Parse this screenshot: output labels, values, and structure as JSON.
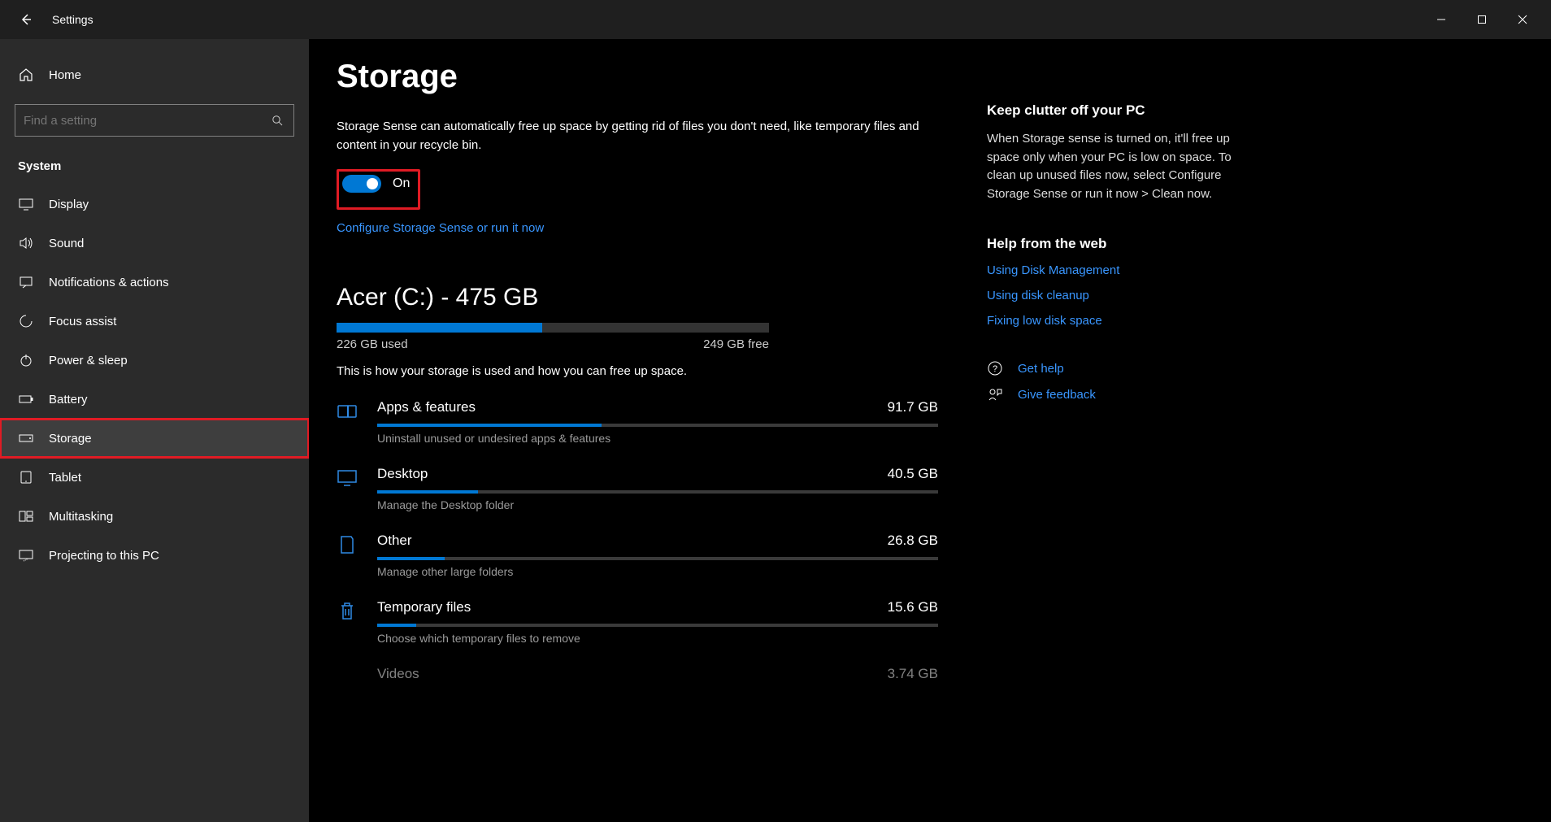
{
  "app": {
    "title": "Settings"
  },
  "sidebar": {
    "home_label": "Home",
    "search_placeholder": "Find a setting",
    "section": "System",
    "items": [
      {
        "label": "Display"
      },
      {
        "label": "Sound"
      },
      {
        "label": "Notifications & actions"
      },
      {
        "label": "Focus assist"
      },
      {
        "label": "Power & sleep"
      },
      {
        "label": "Battery"
      },
      {
        "label": "Storage"
      },
      {
        "label": "Tablet"
      },
      {
        "label": "Multitasking"
      },
      {
        "label": "Projecting to this PC"
      }
    ]
  },
  "main": {
    "title": "Storage",
    "description": "Storage Sense can automatically free up space by getting rid of files you don't need, like temporary files and content in your recycle bin.",
    "toggle_label": "On",
    "configure_link": "Configure Storage Sense or run it now",
    "drive_label": "Acer (C:) - 475 GB",
    "used_text": "226 GB used",
    "free_text": "249 GB free",
    "used_pct": 47.6,
    "usage_desc": "This is how your storage is used and how you can free up space.",
    "categories": [
      {
        "name": "Apps & features",
        "size": "91.7 GB",
        "sub": "Uninstall unused or undesired apps & features",
        "pct": 40
      },
      {
        "name": "Desktop",
        "size": "40.5 GB",
        "sub": "Manage the Desktop folder",
        "pct": 18
      },
      {
        "name": "Other",
        "size": "26.8 GB",
        "sub": "Manage other large folders",
        "pct": 12
      },
      {
        "name": "Temporary files",
        "size": "15.6 GB",
        "sub": "Choose which temporary files to remove",
        "pct": 7
      },
      {
        "name": "Videos",
        "size": "3.74 GB",
        "sub": "",
        "pct": 2
      }
    ]
  },
  "right": {
    "clutter_title": "Keep clutter off your PC",
    "clutter_body": "When Storage sense is turned on, it'll free up space only when your PC is low on space. To clean up unused files now, select Configure Storage Sense or run it now > Clean now.",
    "help_web_title": "Help from the web",
    "help_links": [
      "Using Disk Management",
      "Using disk cleanup",
      "Fixing low disk space"
    ],
    "get_help": "Get help",
    "give_feedback": "Give feedback"
  }
}
